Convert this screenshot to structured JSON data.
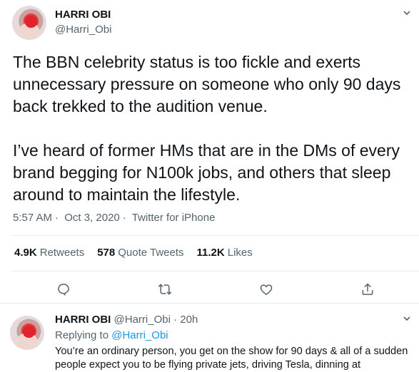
{
  "tweet": {
    "display_name": "HARRI OBI",
    "handle": "@Harri_Obi",
    "text": "The BBN celebrity status is too fickle and exerts unnecessary pressure on someone who only 90 days back trekked to the audition venue.\n\nI’ve heard of former HMs that are in the DMs of every brand begging for N100k jobs, and others that sleep around to maintain the lifestyle.",
    "time": "5:57 AM",
    "date": "Oct 3, 2020",
    "source": "Twitter for iPhone",
    "separator": "·"
  },
  "stats": {
    "retweets_count": "4.9K",
    "retweets_label": "Retweets",
    "quotes_count": "578",
    "quotes_label": "Quote Tweets",
    "likes_count": "11.2K",
    "likes_label": "Likes"
  },
  "actions": [
    "reply-icon",
    "retweet-icon",
    "like-icon",
    "share-icon"
  ],
  "reply": {
    "display_name": "HARRI OBI",
    "handle": "@Harri_Obi",
    "separator": "·",
    "time": "20h",
    "replying_label": "Replying to",
    "replying_to": "@Harri_Obi",
    "text": "You’re an ordinary person, you get on the show for 90 days & all of a sudden people expect you to be flying private jets, driving Tesla, dinning at"
  },
  "colors": {
    "link": "#1b95e0",
    "muted": "#536471",
    "text": "#0f1419",
    "border": "#e6ecf0"
  }
}
